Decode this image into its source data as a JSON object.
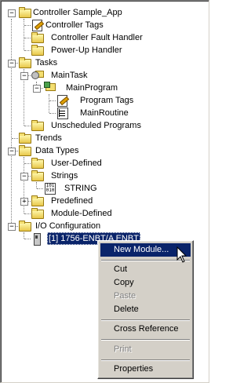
{
  "tree": {
    "controller": "Controller Sample_App",
    "controller_tags": "Controller Tags",
    "fault_handler": "Controller Fault Handler",
    "powerup_handler": "Power-Up Handler",
    "tasks": "Tasks",
    "main_task": "MainTask",
    "main_program": "MainProgram",
    "program_tags": "Program Tags",
    "main_routine": "MainRoutine",
    "unscheduled": "Unscheduled Programs",
    "trends": "Trends",
    "data_types": "Data Types",
    "user_defined": "User-Defined",
    "strings": "Strings",
    "string_type": "STRING",
    "predefined": "Predefined",
    "module_defined": "Module-Defined",
    "io_config": "I/O Configuration",
    "module_item": "[1] 1756-ENBT/A ENBT"
  },
  "context_menu": {
    "new_module": "New Module...",
    "cut": "Cut",
    "copy": "Copy",
    "paste": "Paste",
    "delete": "Delete",
    "cross_reference": "Cross Reference",
    "print": "Print",
    "properties": "Properties"
  },
  "colors": {
    "selection": "#0a246a",
    "menu_bg": "#d4d0c8",
    "disabled_text": "#808080"
  }
}
